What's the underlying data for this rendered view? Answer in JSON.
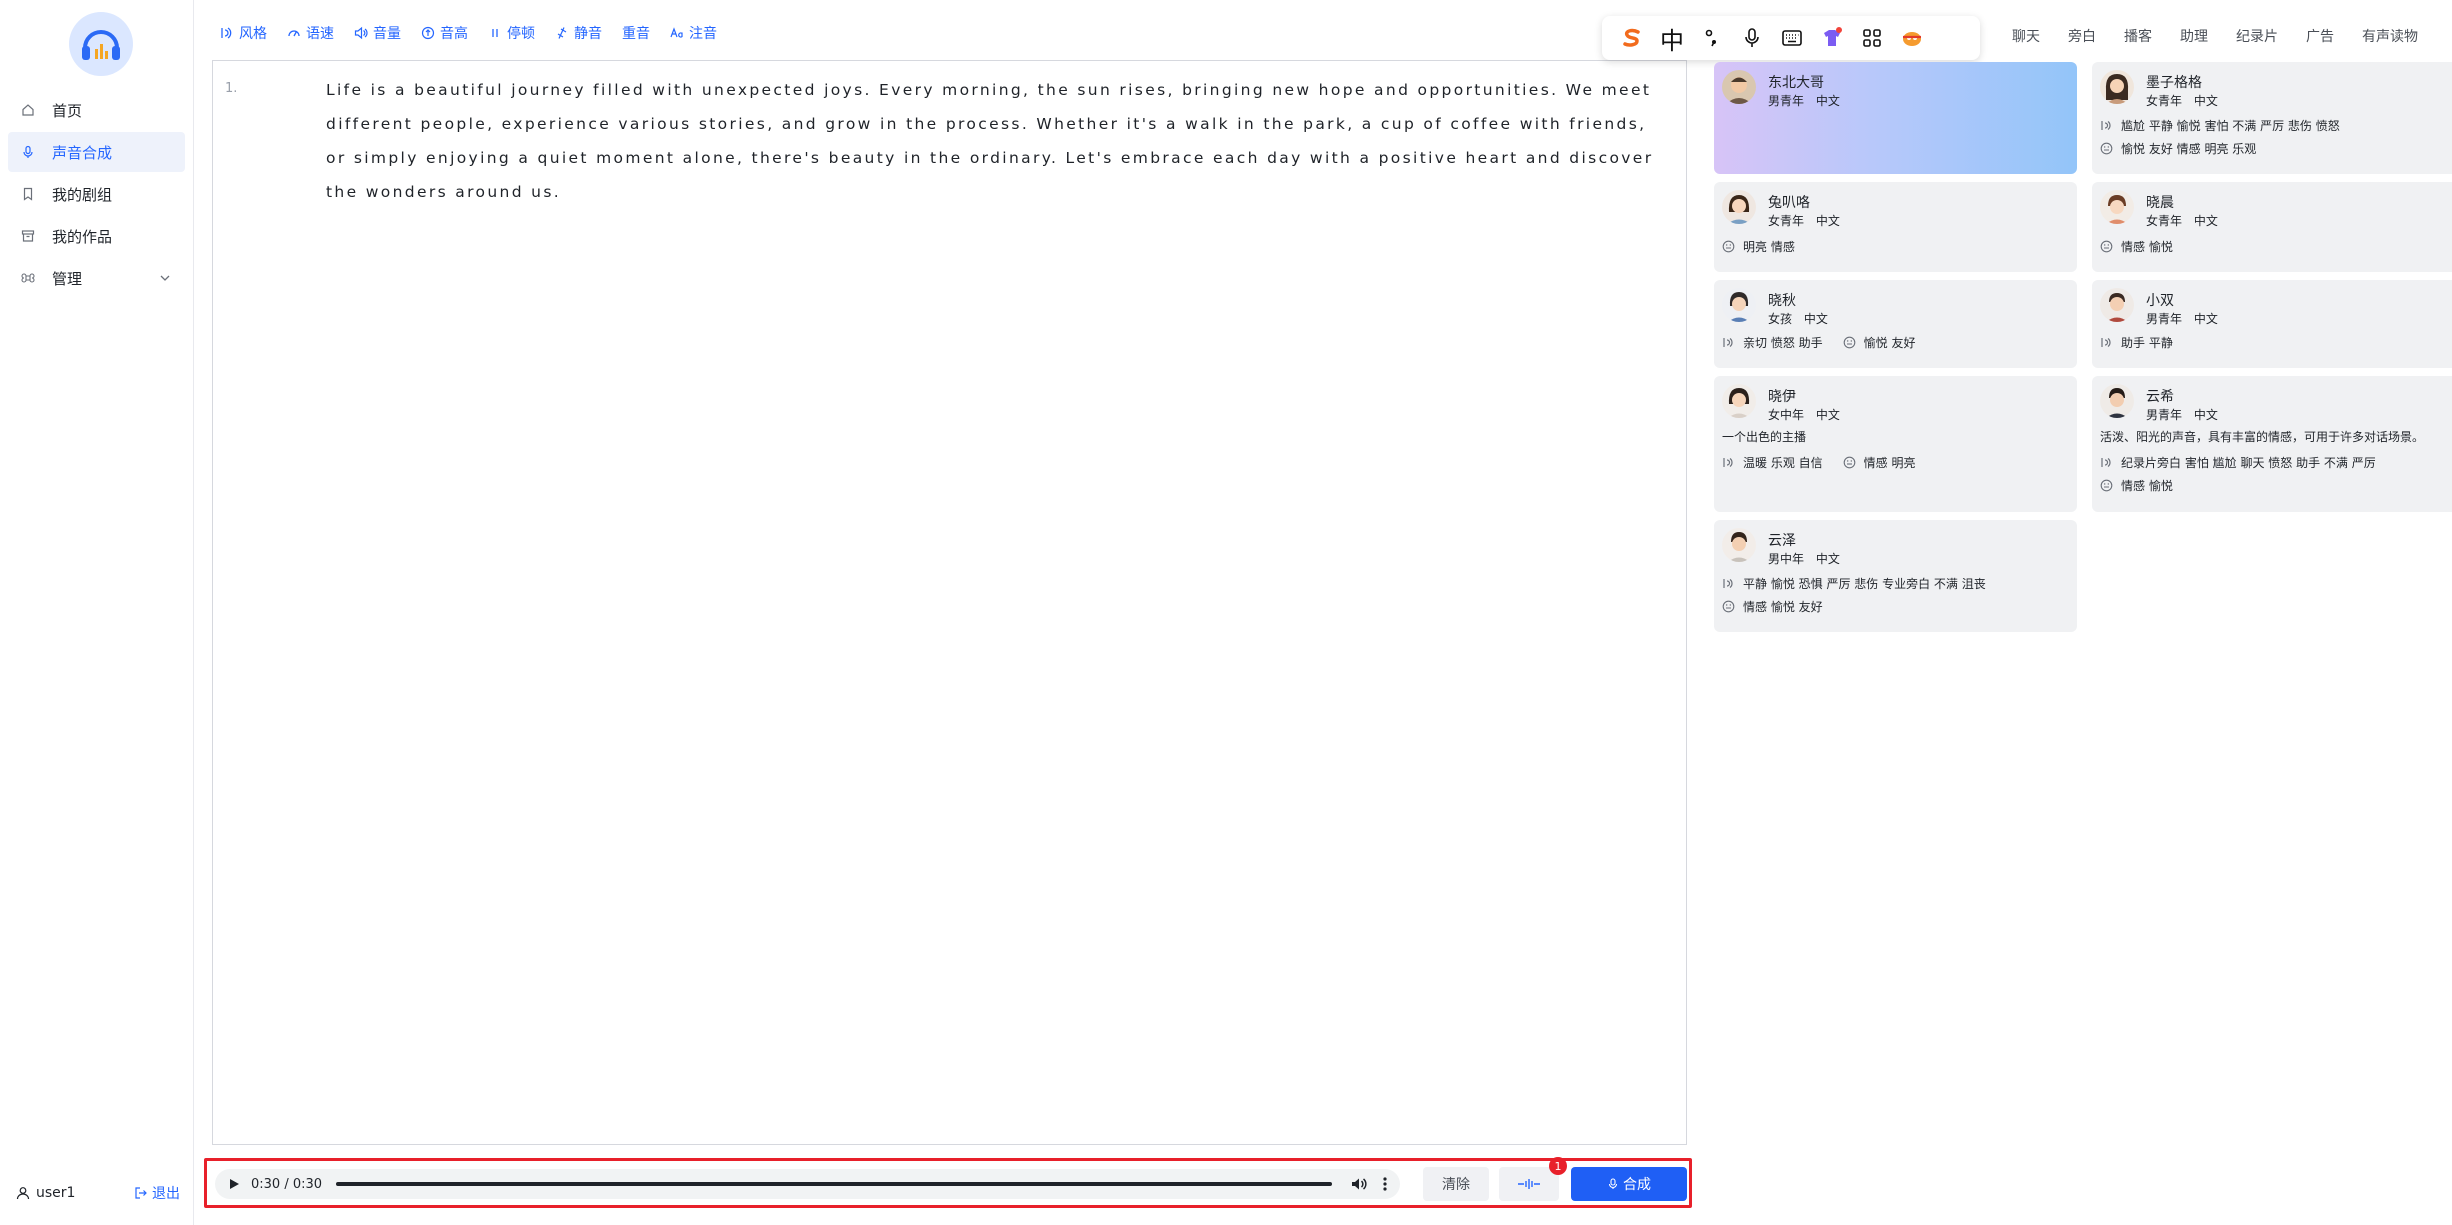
{
  "sidebar": {
    "items": [
      {
        "label": "首页",
        "icon": "home-icon"
      },
      {
        "label": "声音合成",
        "icon": "mic-icon"
      },
      {
        "label": "我的剧组",
        "icon": "bookmark-icon"
      },
      {
        "label": "我的作品",
        "icon": "archive-icon"
      },
      {
        "label": "管理",
        "icon": "command-icon"
      }
    ],
    "user": "user1",
    "logout": "退出"
  },
  "toolbar": {
    "items": [
      {
        "label": "风格",
        "icon": "style-icon"
      },
      {
        "label": "语速",
        "icon": "speed-icon"
      },
      {
        "label": "音量",
        "icon": "volume-icon"
      },
      {
        "label": "音高",
        "icon": "pitch-icon"
      },
      {
        "label": "停顿",
        "icon": "pause-icon"
      },
      {
        "label": "静音",
        "icon": "mute-icon"
      },
      {
        "label": "重音",
        "icon": ""
      },
      {
        "label": "注音",
        "icon": "phonetic-icon"
      }
    ]
  },
  "editor": {
    "line_number": "1.",
    "text": "Life is a beautiful journey filled with unexpected joys. Every morning, the sun rises, bringing new hope and opportunities. We meet different people, experience various stories, and grow in the process. Whether it's a walk in the park, a cup of coffee with friends, or simply enjoying a quiet moment alone, there's beauty in the ordinary. Let's embrace each day with a positive heart and discover the wonders around us."
  },
  "player": {
    "time": "0:30 / 0:30",
    "progress": 1.0,
    "clear_label": "清除",
    "badge": "1",
    "synth_label": "合成"
  },
  "ime": {
    "lang": "中"
  },
  "categories": [
    "聊天",
    "旁白",
    "播客",
    "助理",
    "纪录片",
    "广告",
    "有声读物"
  ],
  "voices": {
    "c0": {
      "name": "东北大哥",
      "meta": "男青年 中文"
    },
    "c1": {
      "name": "墨子格格",
      "meta": "女青年 中文",
      "tags1": "尴尬 平静 愉悦 害怕 不满 严厉 悲伤 愤怒",
      "tags2": "愉悦 友好 情感 明亮 乐观"
    },
    "c2": {
      "name": "兔叭咯",
      "meta": "女青年 中文",
      "tags2": "明亮 情感"
    },
    "c3": {
      "name": "晓晨",
      "meta": "女青年 中文",
      "tags2": "情感 愉悦"
    },
    "c4": {
      "name": "晓秋",
      "meta": "女孩 中文",
      "tags1": "亲切 愤怒 助手",
      "tags2": "愉悦 友好"
    },
    "c5": {
      "name": "小双",
      "meta": "男青年 中文",
      "tags1": "助手 平静"
    },
    "c6": {
      "name": "晓伊",
      "meta": "女中年 中文",
      "desc": "一个出色的主播",
      "tags1": "温暖 乐观 自信",
      "tags2": "情感 明亮"
    },
    "c7": {
      "name": "云希",
      "meta": "男青年 中文",
      "desc": "活泼、阳光的声音，具有丰富的情感，可用于许多对话场景。",
      "tags1": "纪录片旁白 害怕 尴尬 聊天 愤怒 助手 不满 严厉",
      "tags2": "情感 愉悦"
    },
    "c8": {
      "name": "云泽",
      "meta": "男中年 中文",
      "tags1": "平静 愉悦 恐惧 严厉 悲伤 专业旁白 不满 沮丧",
      "tags2": "情感 愉悦 友好"
    }
  },
  "colors": {
    "accent": "#2566ff",
    "highlight": "#e8202a",
    "synth": "#1f5ff5"
  }
}
